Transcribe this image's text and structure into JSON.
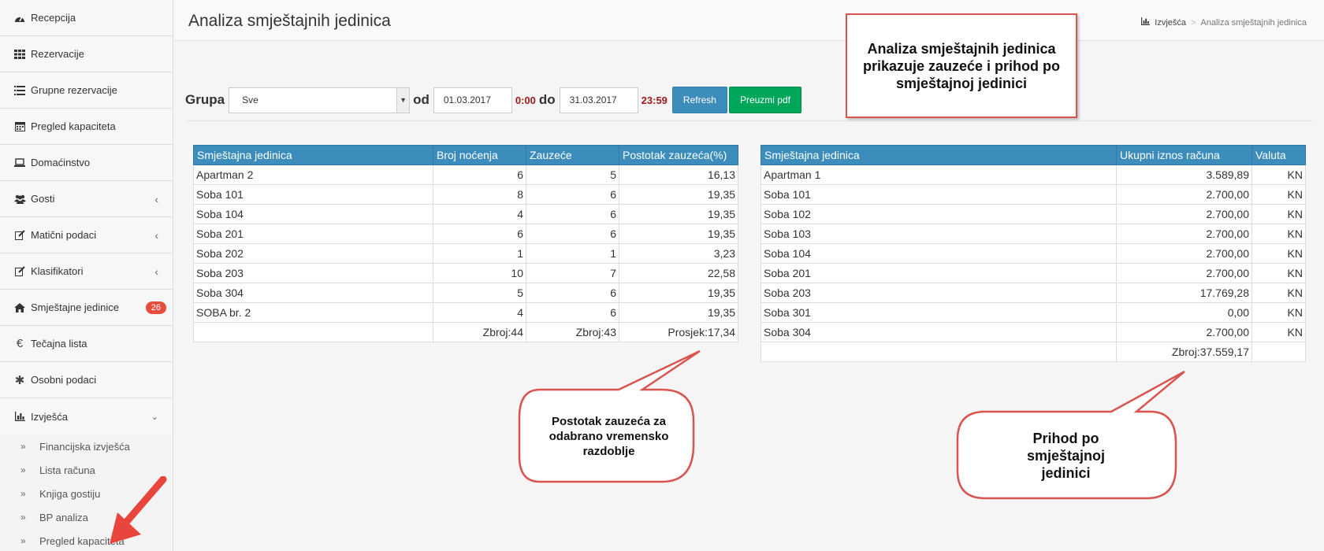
{
  "sidebar": {
    "items": [
      {
        "label": "Recepcija",
        "icon": "dashboard-icon"
      },
      {
        "label": "Rezervacije",
        "icon": "grid-icon"
      },
      {
        "label": "Grupne rezervacije",
        "icon": "list-icon"
      },
      {
        "label": "Pregled kapaciteta",
        "icon": "calendar-icon"
      },
      {
        "label": "Domaćinstvo",
        "icon": "laptop-icon"
      },
      {
        "label": "Gosti",
        "icon": "users-icon"
      },
      {
        "label": "Matični podaci",
        "icon": "edit-icon"
      },
      {
        "label": "Klasifikatori",
        "icon": "edit-icon"
      },
      {
        "label": "Smještajne jedinice",
        "icon": "home-icon",
        "badge": "26"
      },
      {
        "label": "Tečajna lista",
        "icon": "euro-icon"
      },
      {
        "label": "Osobni podaci",
        "icon": "asterisk-icon"
      },
      {
        "label": "Izvješća",
        "icon": "bar-chart-icon"
      }
    ],
    "subitems": [
      {
        "label": "Financijska izvješća"
      },
      {
        "label": "Lista računa"
      },
      {
        "label": "Knjiga gostiju"
      },
      {
        "label": "BP analiza"
      },
      {
        "label": "Pregled kapaciteta"
      }
    ]
  },
  "header": {
    "title": "Analiza smještajnih jedinica",
    "breadcrumb": [
      "Izvješća",
      "Analiza smještajnih jedinica"
    ]
  },
  "filter": {
    "group_label": "Grupa",
    "group_value": "Sve",
    "from_label": "od",
    "from_date": "01.03.2017",
    "from_time": "0:00",
    "to_label": "do",
    "to_date": "31.03.2017",
    "to_time": "23:59",
    "refresh": "Refresh",
    "pdf": "Preuzmi pdf"
  },
  "occupancy_table": {
    "headers": [
      "Smještajna jedinica",
      "Broj noćenja",
      "Zauzeće",
      "Postotak zauzeća(%)"
    ],
    "rows": [
      [
        "Apartman 2",
        "6",
        "5",
        "16,13"
      ],
      [
        "Soba 101",
        "8",
        "6",
        "19,35"
      ],
      [
        "Soba 104",
        "4",
        "6",
        "19,35"
      ],
      [
        "Soba 201",
        "6",
        "6",
        "19,35"
      ],
      [
        "Soba 202",
        "1",
        "1",
        "3,23"
      ],
      [
        "Soba 203",
        "10",
        "7",
        "22,58"
      ],
      [
        "Soba 304",
        "5",
        "6",
        "19,35"
      ],
      [
        "SOBA br. 2",
        "4",
        "6",
        "19,35"
      ]
    ],
    "footer": [
      "",
      "Zbroj:44",
      "Zbroj:43",
      "Prosjek:17,34"
    ]
  },
  "revenue_table": {
    "headers": [
      "Smještajna jedinica",
      "Ukupni iznos računa",
      "Valuta"
    ],
    "rows": [
      [
        "Apartman 1",
        "3.589,89",
        "KN"
      ],
      [
        "Soba 101",
        "2.700,00",
        "KN"
      ],
      [
        "Soba 102",
        "2.700,00",
        "KN"
      ],
      [
        "Soba 103",
        "2.700,00",
        "KN"
      ],
      [
        "Soba 104",
        "2.700,00",
        "KN"
      ],
      [
        "Soba 201",
        "2.700,00",
        "KN"
      ],
      [
        "Soba 203",
        "17.769,28",
        "KN"
      ],
      [
        "Soba 301",
        "0,00",
        "KN"
      ],
      [
        "Soba 304",
        "2.700,00",
        "KN"
      ]
    ],
    "footer": [
      "",
      "Zbroj:37.559,17",
      ""
    ]
  },
  "callouts": {
    "top": "Analiza smještajnih jedinica prikazuje zauzeće i  prihod po smještajnoj jedinici",
    "occupancy": "Postotak zauzeća za odabrano vremensko razdoblje",
    "revenue": "Prihod po smještajnoj jedinici"
  },
  "colors": {
    "accent": "#3c8dbc",
    "success": "#00a65a",
    "callout_border": "#d9534f",
    "badge": "#e84c3d"
  }
}
